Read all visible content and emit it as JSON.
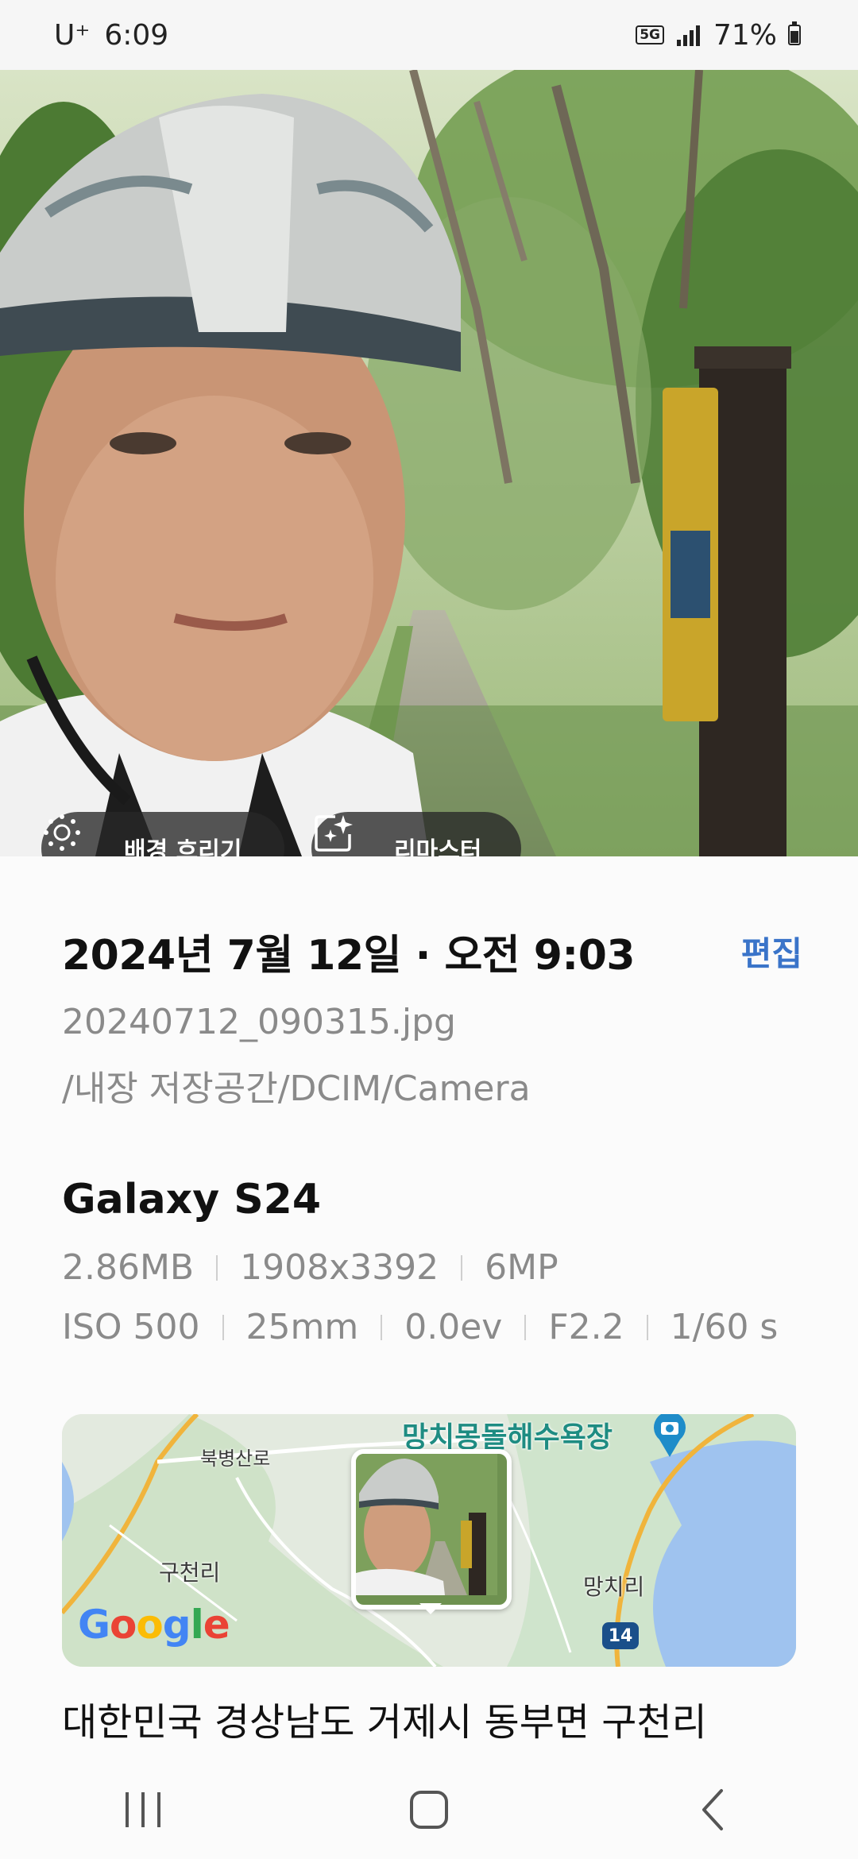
{
  "status_bar": {
    "carrier": "U⁺",
    "time": "6:09",
    "network": "5G",
    "battery": "71%"
  },
  "photo_actions": {
    "background_blur_label": "배경 흐리기",
    "remaster_label": "리마스터"
  },
  "details": {
    "date_time": "2024년 7월 12일 · 오전 9:03",
    "edit_label": "편집",
    "filename": "20240712_090315.jpg",
    "path": "/내장 저장공간/DCIM/Camera"
  },
  "camera": {
    "device": "Galaxy S24",
    "size": "2.86MB",
    "resolution": "1908x3392",
    "megapixels": "6MP",
    "iso": "ISO 500",
    "focal_length": "25mm",
    "exposure": "0.0ev",
    "aperture": "F2.2",
    "shutter": "1/60 s"
  },
  "map": {
    "poi": "망치몽돌해수욕장",
    "road_label": "북병산로",
    "place_left": "구천리",
    "place_right": "망치리",
    "route_number": "14",
    "logo_letters": [
      "G",
      "o",
      "o",
      "g",
      "l",
      "e"
    ]
  },
  "location": {
    "address": "대한민국 경상남도 거제시 동부면 구천리"
  },
  "colors": {
    "accent": "#3a74c9",
    "muted_text": "#8a8a8a",
    "chip_bg": "#282828"
  },
  "icons": {
    "blur": "blur-sun-icon",
    "remaster": "sparkle-frame-icon",
    "map_pin": "camera-pin-icon",
    "nav": [
      "recent-apps-icon",
      "home-icon",
      "back-icon"
    ]
  }
}
